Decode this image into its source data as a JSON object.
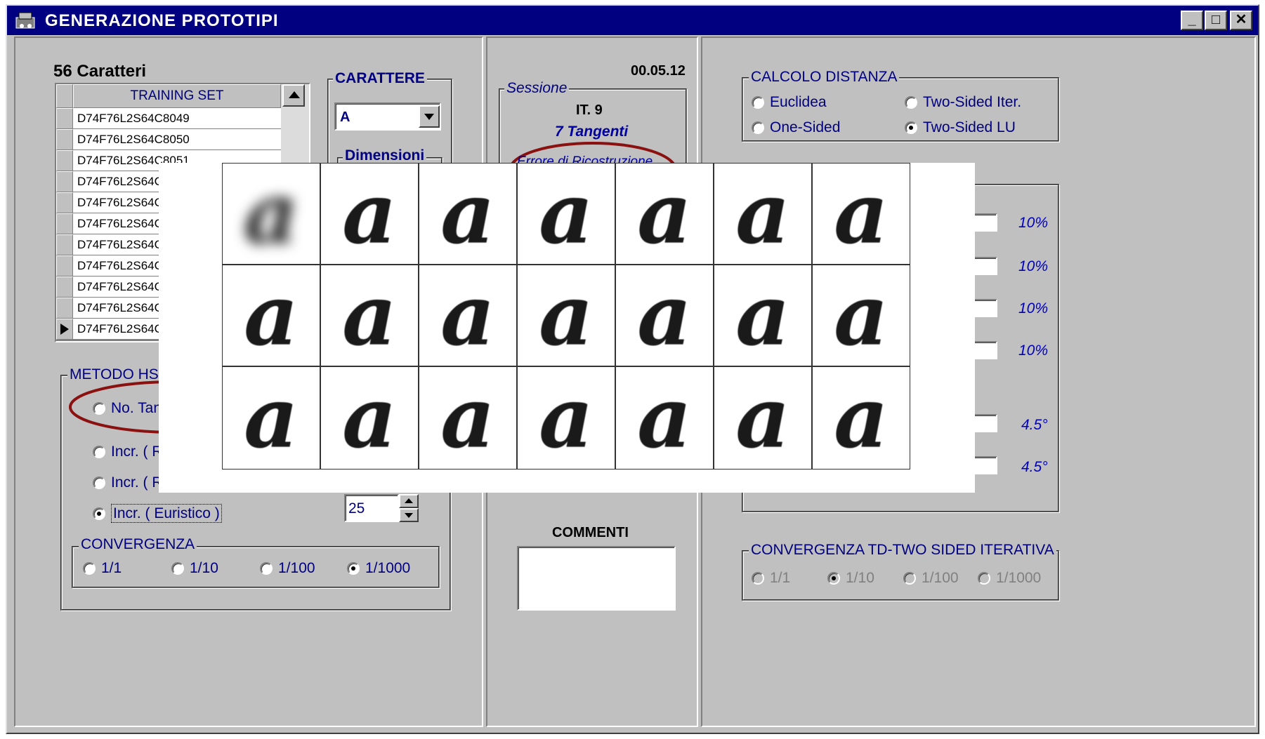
{
  "window": {
    "title": "GENERAZIONE PROTOTIPI",
    "minimize": "_",
    "maximize": "□",
    "close": "✕"
  },
  "left": {
    "chars_title": "56  Caratteri",
    "training_header": "TRAINING SET",
    "training_rows": [
      "D74F76L2S64C8049",
      "D74F76L2S64C8050",
      "D74F76L2S64C8051",
      "D74F76L2S64C",
      "D74F76L2S64C",
      "D74F76L2S64C",
      "D74F76L2S64C",
      "D74F76L2S64C",
      "D74F76L2S64C",
      "D74F76L2S64C",
      "D74F76L2S64C"
    ],
    "carattere_title": "CARATTERE",
    "carattere_value": "A",
    "dimensioni_title": "Dimensioni",
    "metodo_title": "METODO HSS",
    "metodo_options": [
      "No. Tang",
      "Incr. ( Ri",
      "Incr. ( Ri",
      "Incr. ( Euristico )"
    ],
    "spin_value": "25",
    "convergenza_title": "CONVERGENZA",
    "convergenza_options": [
      "1/1",
      "1/10",
      "1/100",
      "1/1000"
    ]
  },
  "middle": {
    "date": "00.05.12",
    "sessione_title": "Sessione",
    "iteration": "IT.  9",
    "tangenti": "7 Tangenti",
    "errore": "Errore di Ricostruzione",
    "commenti_title": "COMMENTI"
  },
  "right": {
    "calcolo_title": "CALCOLO DISTANZA",
    "calcolo_options": [
      "Euclidea",
      "Two-Sided Iter.",
      "One-Sided",
      "Two-Sided LU"
    ],
    "percent_values": [
      "10%",
      "10%",
      "10%",
      "10%"
    ],
    "degree_values": [
      "4.5°",
      "4.5°"
    ],
    "convergenza_td_title": "CONVERGENZA TD-TWO SIDED ITERATIVA",
    "convergenza_td_options": [
      "1/1",
      "1/10",
      "1/100",
      "1/1000"
    ]
  },
  "icons": {
    "title": "app-icon",
    "dropdown": "chevron-down-icon",
    "scroll_up": "arrow-up-icon",
    "row_pointer": "triangle-right-icon"
  },
  "colors": {
    "title_bar": "#000080",
    "face": "#c0c0c0",
    "label_blue": "#000080",
    "accent_red": "#8b0000"
  },
  "glyphs": [
    "a",
    "a",
    "a",
    "a",
    "a",
    "a",
    "a",
    "a",
    "a",
    "a",
    "a",
    "a",
    "a",
    "a",
    "a",
    "a",
    "a",
    "a",
    "a",
    "a",
    "a"
  ]
}
